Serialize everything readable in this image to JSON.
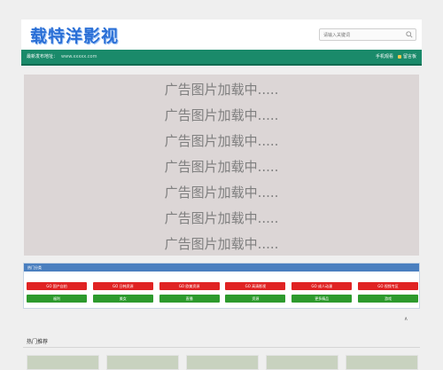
{
  "header": {
    "logo_text": "载特洋影视",
    "search_placeholder": "请输入关键词"
  },
  "navbar": {
    "label": "最新发布地址：",
    "url": "www.xxxxx.com",
    "links": [
      "手机观看",
      "留言板"
    ]
  },
  "ad": {
    "lines": [
      "广告图片加载中.....",
      "广告图片加载中.....",
      "广告图片加载中.....",
      "广告图片加载中.....",
      "广告图片加载中.....",
      "广告图片加载中.....",
      "广告图片加载中....."
    ]
  },
  "categories": {
    "header": "热门分类",
    "red_buttons": [
      "GO 国产自拍",
      "GO 日韩资源",
      "GO 欧美资源",
      "GO 高清影视",
      "GO 成人动漫",
      "GO 视频专区"
    ],
    "green_buttons": [
      "福利",
      "美女",
      "直播",
      "资源",
      "更多精品",
      "游戏"
    ],
    "colors": {
      "red": "#e02323",
      "green": "#2d9a2d",
      "header": "#4a7fbf"
    }
  },
  "scroll_top": "∧",
  "hot": {
    "title": "热门推荐"
  },
  "colors": {
    "navbar": "#1a8a6a",
    "logo": "#2a6fd6"
  }
}
